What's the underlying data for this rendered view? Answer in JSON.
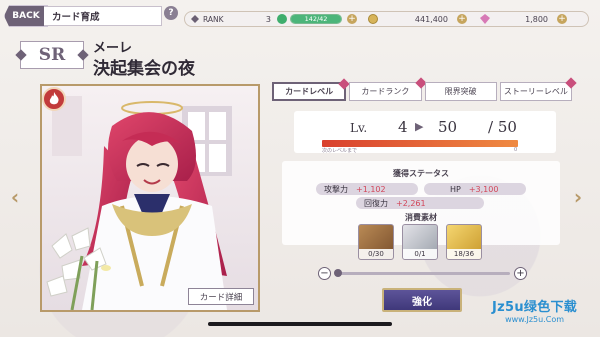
{
  "header": {
    "back_label": "BACK",
    "page_title": "カード育成",
    "help_label": "?"
  },
  "status": {
    "rank_label": "RANK",
    "rank_value": "3",
    "stamina_text": "142/42",
    "stamina_fraction": 1.0,
    "coins": "441,400",
    "gems": "1,800"
  },
  "card": {
    "rarity": "SR",
    "character_name": "メーレ",
    "card_title": "決起集会の夜",
    "detail_button": "カード詳細"
  },
  "tabs": [
    {
      "label": "カードレベル",
      "active": true
    },
    {
      "label": "カードランク",
      "active": false
    },
    {
      "label": "限界突破",
      "active": false
    },
    {
      "label": "ストーリーレベル",
      "active": false
    }
  ],
  "level": {
    "lv_label": "Lv.",
    "current": "4",
    "next": "50",
    "separator": "/",
    "max": "50",
    "exp_caption": "次のレベルまで",
    "exp_zero": "0",
    "exp_fraction": 1.0
  },
  "stats": {
    "title": "獲得ステータス",
    "attack_label": "攻撃力",
    "attack_value": "+1,102",
    "hp_label": "HP",
    "hp_value": "+3,100",
    "recovery_label": "回復力",
    "recovery_value": "+2,261"
  },
  "materials": {
    "title": "消費素材",
    "items": [
      {
        "count": "0/30"
      },
      {
        "count": "0/1"
      },
      {
        "count": "18/36"
      }
    ],
    "minus": "−",
    "plus": "+",
    "slider_fraction": 0.0
  },
  "power_button": "強化",
  "watermark": {
    "line1": "Jz5u绿色下载",
    "line2": "www.Jz5u.Com"
  },
  "colors": {
    "accent": "#6e6277",
    "gold": "#b89a6a",
    "stat_value": "#d2465a",
    "power_button": "#4a4288"
  }
}
